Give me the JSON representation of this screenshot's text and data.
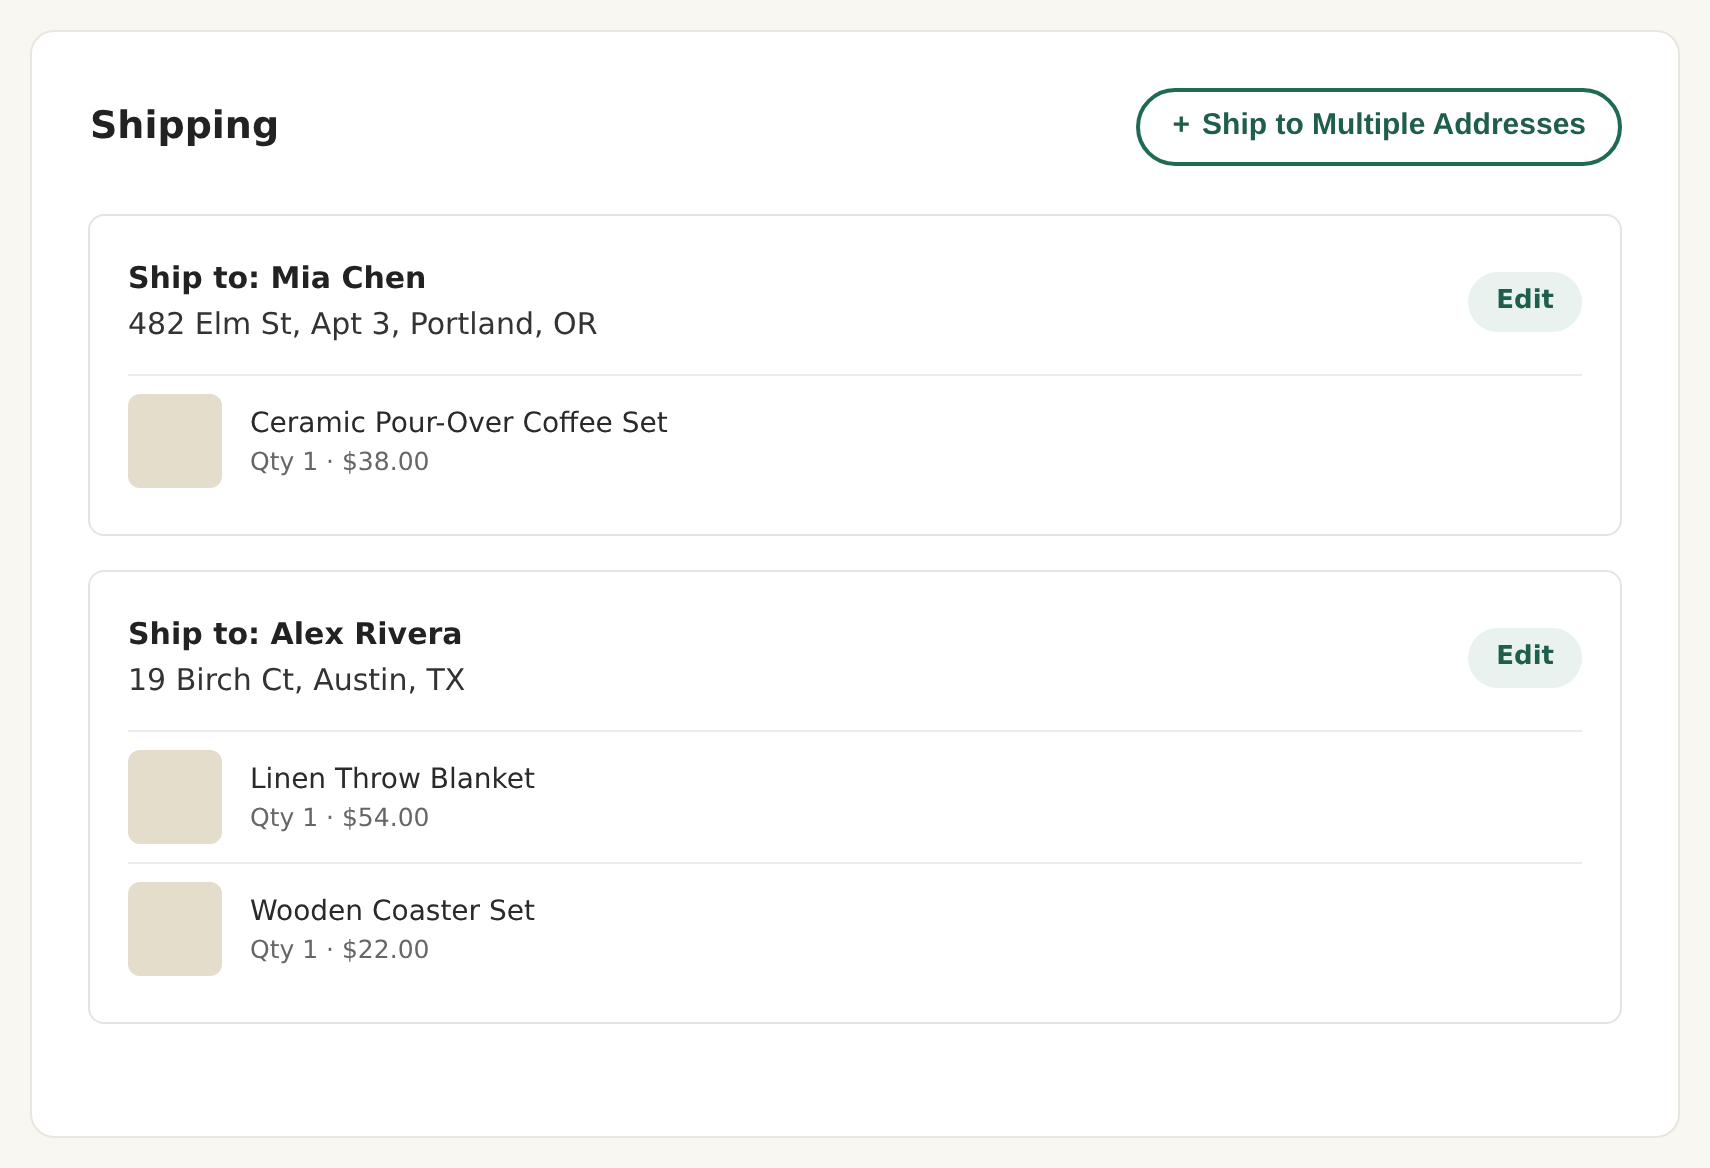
{
  "title": "Shipping",
  "add_button": {
    "icon": "+",
    "label": "Ship to Multiple Addresses"
  },
  "shipments": [
    {
      "heading": "Ship to: Mia Chen",
      "address": "482 Elm St, Apt 3, Portland, OR",
      "edit_label": "Edit",
      "items": [
        {
          "name": "Ceramic Pour-Over Coffee Set",
          "meta": "Qty 1 · $38.00"
        }
      ]
    },
    {
      "heading": "Ship to: Alex Rivera",
      "address": "19 Birch Ct, Austin, TX",
      "edit_label": "Edit",
      "items": [
        {
          "name": "Linen Throw Blanket",
          "meta": "Qty 1 · $54.00"
        },
        {
          "name": "Wooden Coaster Set",
          "meta": "Qty 1 · $22.00"
        }
      ]
    }
  ]
}
